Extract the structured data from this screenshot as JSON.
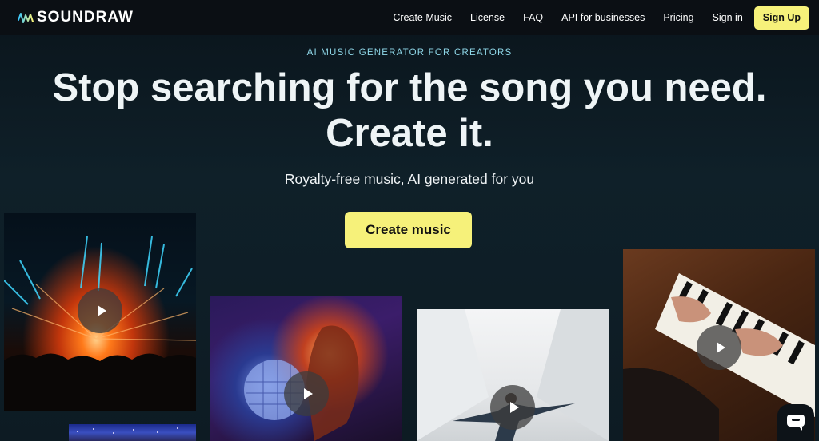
{
  "header": {
    "brand": "SOUNDRAW",
    "nav": [
      {
        "label": "Create Music"
      },
      {
        "label": "License"
      },
      {
        "label": "FAQ"
      },
      {
        "label": "API for businesses"
      },
      {
        "label": "Pricing"
      },
      {
        "label": "Sign in"
      }
    ],
    "signup_label": "Sign Up"
  },
  "hero": {
    "eyebrow": "AI MUSIC GENERATOR FOR CREATORS",
    "headline_line1": "Stop searching for the song you need.",
    "headline_line2": "Create it.",
    "subhead": "Royalty-free music, AI generated for you",
    "cta_label": "Create music"
  },
  "colors": {
    "accent": "#f6f17a",
    "header_bg": "#0b0f14",
    "page_bg": "#0d1a22",
    "eyebrow": "#8fd7e8"
  },
  "icons": {
    "logo": "soundwave-logo-icon",
    "play": "play-icon",
    "chat": "chat-bubble-icon"
  }
}
